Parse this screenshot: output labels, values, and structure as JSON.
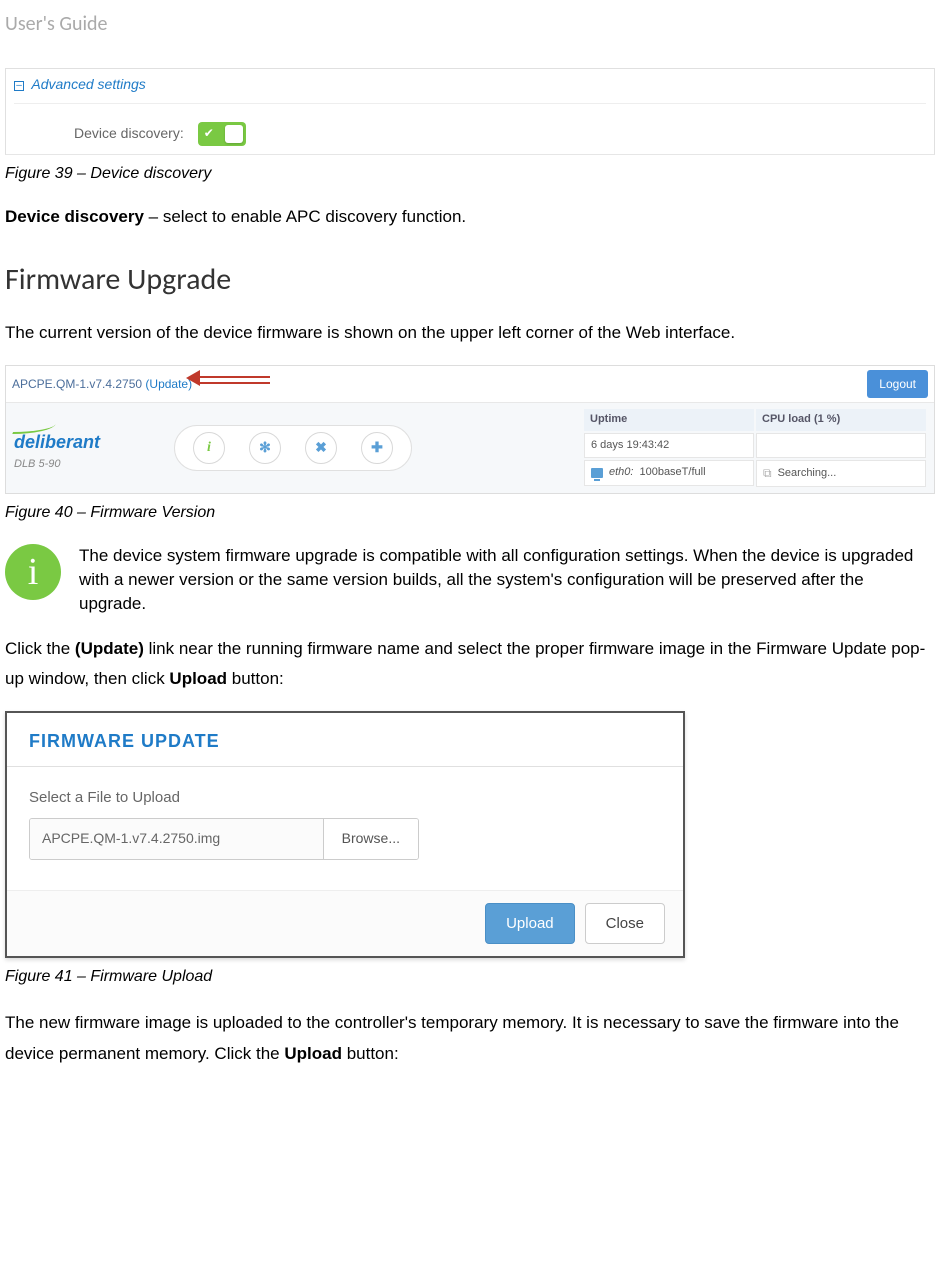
{
  "header": "User's Guide",
  "fig39": {
    "panel_title": "Advanced settings",
    "label": "Device discovery:",
    "caption": "Figure 39 – Device discovery"
  },
  "device_discovery": {
    "label": "Device discovery",
    "desc": " – select to enable  APC discovery function."
  },
  "section_title": "Firmware Upgrade",
  "intro": "The current version of the device firmware is shown on the upper left corner of the Web interface.",
  "fig40": {
    "fw": "APCPE.QM-1.v7.4.2750",
    "update": "(Update)",
    "logout": "Logout",
    "brand": "deliberant",
    "model": "DLB 5-90",
    "uptime_label": "Uptime",
    "uptime_value": "6 days 19:43:42",
    "cpu_label": "CPU load (1 %)",
    "eth_label": "eth0:",
    "eth_value": "100baseT/full",
    "wifi_value": "Searching...",
    "caption": "Figure 40 – Firmware Version"
  },
  "note": "The device system firmware upgrade is compatible with all configuration settings. When the device is upgraded with a newer version or the same version builds, all the system's configuration will be preserved after the upgrade.",
  "para1a": "Click the ",
  "para1b": "(Update)",
  "para1c": " link near the running firmware name and select the proper firmware image in the Firmware Update pop-up window, then click ",
  "para1d": "Upload",
  "para1e": " button:",
  "fig41": {
    "title": "FIRMWARE UPDATE",
    "select_label": "Select a File to Upload",
    "filename": "APCPE.QM-1.v7.4.2750.img",
    "browse": "Browse...",
    "upload": "Upload",
    "close": "Close",
    "caption": "Figure 41 – Firmware Upload"
  },
  "para2a": "The new firmware image is uploaded to the controller's temporary memory. It is necessary to save the firmware into the device permanent memory. Click the ",
  "para2b": "Upload",
  "para2c": " button:"
}
